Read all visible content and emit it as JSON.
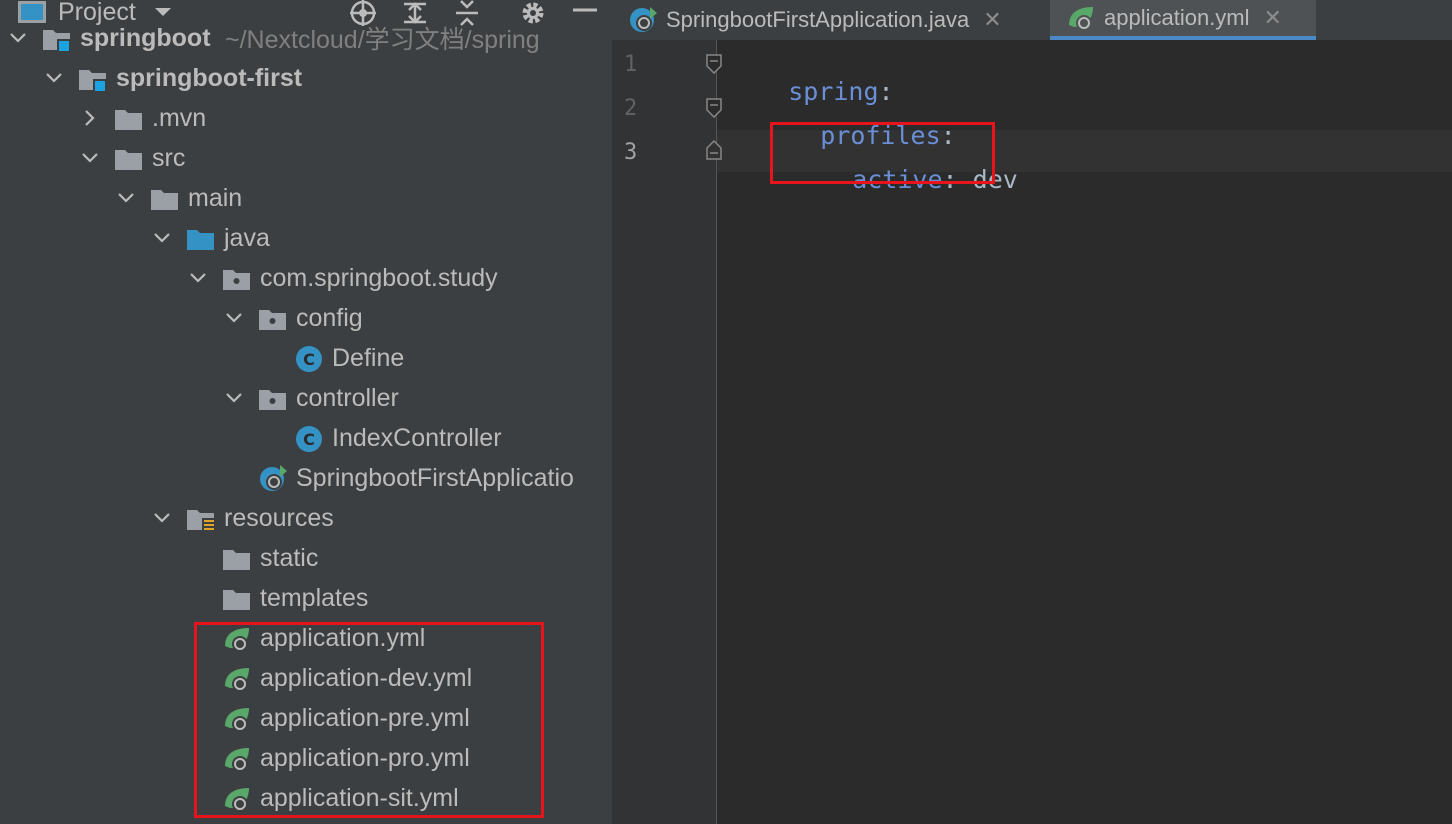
{
  "panel": {
    "title": "Project",
    "tools": [
      "locate-icon",
      "expand-all-icon",
      "collapse-all-icon",
      "gear-icon",
      "minimize-icon"
    ]
  },
  "tree": [
    {
      "label": "springboot",
      "hint": "~/Nextcloud/学习文档/spring",
      "depth": 0,
      "expanded": true,
      "icon": "module-folder-icon"
    },
    {
      "label": "springboot-first",
      "depth": 1,
      "expanded": true,
      "icon": "module-folder-icon"
    },
    {
      "label": ".mvn",
      "depth": 2,
      "expanded": false,
      "icon": "folder-icon"
    },
    {
      "label": "src",
      "depth": 2,
      "expanded": true,
      "icon": "folder-icon"
    },
    {
      "label": "main",
      "depth": 3,
      "expanded": true,
      "icon": "folder-icon"
    },
    {
      "label": "java",
      "depth": 4,
      "expanded": true,
      "icon": "source-folder-icon"
    },
    {
      "label": "com.springboot.study",
      "depth": 5,
      "expanded": true,
      "icon": "package-icon"
    },
    {
      "label": "config",
      "depth": 6,
      "expanded": true,
      "icon": "package-icon"
    },
    {
      "label": "Define",
      "depth": 7,
      "icon": "class-icon"
    },
    {
      "label": "controller",
      "depth": 6,
      "expanded": true,
      "icon": "package-icon"
    },
    {
      "label": "IndexController",
      "depth": 7,
      "icon": "class-icon"
    },
    {
      "label": "SpringbootFirstApplicatio",
      "depth": 6,
      "icon": "spring-boot-app-icon"
    },
    {
      "label": "resources",
      "depth": 4,
      "expanded": true,
      "icon": "resources-folder-icon"
    },
    {
      "label": "static",
      "depth": 5,
      "icon": "folder-icon"
    },
    {
      "label": "templates",
      "depth": 5,
      "icon": "folder-icon"
    },
    {
      "label": "application.yml",
      "depth": 5,
      "icon": "spring-config-icon"
    },
    {
      "label": "application-dev.yml",
      "depth": 5,
      "icon": "spring-config-icon"
    },
    {
      "label": "application-pre.yml",
      "depth": 5,
      "icon": "spring-config-icon"
    },
    {
      "label": "application-pro.yml",
      "depth": 5,
      "icon": "spring-config-icon"
    },
    {
      "label": "application-sit.yml",
      "depth": 5,
      "icon": "spring-config-icon"
    }
  ],
  "tabs": [
    {
      "label": "SpringbootFirstApplication.java",
      "active": false
    },
    {
      "label": "application.yml",
      "active": true
    }
  ],
  "editor": {
    "line_numbers": [
      "1",
      "2",
      "3"
    ],
    "lines": [
      {
        "key": "spring",
        "colon": ":",
        "value": ""
      },
      {
        "key": "profiles",
        "colon": ":",
        "value": ""
      },
      {
        "key": "active",
        "colon": ":",
        "value": " dev"
      }
    ]
  },
  "colors": {
    "highlight": "#e8141b",
    "accent": "#4a88c7",
    "yaml_key": "#6a8fd6"
  }
}
